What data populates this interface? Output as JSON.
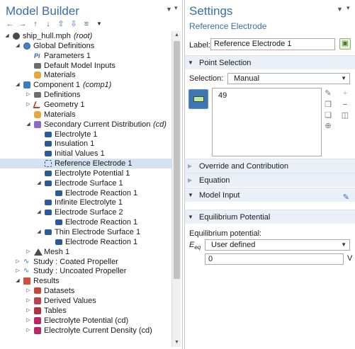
{
  "left": {
    "title": "Model Builder",
    "pin_icon": "pin-icon",
    "toolbar": [
      "back-icon",
      "forward-icon",
      "move-up-icon",
      "move-down-icon",
      "expand-all-icon",
      "sort-icon",
      "menu-icon"
    ],
    "tree": [
      {
        "label": "ship_hull.mph",
        "suffix": "(root)",
        "depth": 0,
        "expander": "expanded",
        "icon": "file"
      },
      {
        "label": "Global Definitions",
        "suffix": "",
        "depth": 1,
        "expander": "expanded",
        "icon": "globe"
      },
      {
        "label": "Parameters 1",
        "suffix": "",
        "depth": 2,
        "expander": "none",
        "icon": "param"
      },
      {
        "label": "Default Model Inputs",
        "suffix": "",
        "depth": 2,
        "expander": "none",
        "icon": "defs"
      },
      {
        "label": "Materials",
        "suffix": "",
        "depth": 2,
        "expander": "none",
        "icon": "mat"
      },
      {
        "label": "Component 1",
        "suffix": "(comp1)",
        "depth": 1,
        "expander": "expanded",
        "icon": "comp"
      },
      {
        "label": "Definitions",
        "suffix": "",
        "depth": 2,
        "expander": "collapsed",
        "icon": "defs"
      },
      {
        "label": "Geometry 1",
        "suffix": "",
        "depth": 2,
        "expander": "collapsed",
        "icon": "geo"
      },
      {
        "label": "Materials",
        "suffix": "",
        "depth": 2,
        "expander": "none",
        "icon": "mat"
      },
      {
        "label": "Secondary Current Distribution",
        "suffix": "(cd)",
        "depth": 2,
        "expander": "expanded",
        "icon": "physics"
      },
      {
        "label": "Electrolyte 1",
        "suffix": "",
        "depth": 3,
        "expander": "none",
        "icon": "node"
      },
      {
        "label": "Insulation 1",
        "suffix": "",
        "depth": 3,
        "expander": "none",
        "icon": "node"
      },
      {
        "label": "Initial Values 1",
        "suffix": "",
        "depth": 3,
        "expander": "none",
        "icon": "node"
      },
      {
        "label": "Reference Electrode 1",
        "suffix": "",
        "depth": 3,
        "expander": "none",
        "icon": "refel",
        "selected": true
      },
      {
        "label": "Electrolyte Potential 1",
        "suffix": "",
        "depth": 3,
        "expander": "none",
        "icon": "node"
      },
      {
        "label": "Electrode Surface 1",
        "suffix": "",
        "depth": 3,
        "expander": "expanded",
        "icon": "node"
      },
      {
        "label": "Electrode Reaction 1",
        "suffix": "",
        "depth": 4,
        "expander": "none",
        "icon": "node"
      },
      {
        "label": "Infinite Electrolyte 1",
        "suffix": "",
        "depth": 3,
        "expander": "none",
        "icon": "node"
      },
      {
        "label": "Electrode Surface 2",
        "suffix": "",
        "depth": 3,
        "expander": "expanded",
        "icon": "node"
      },
      {
        "label": "Electrode Reaction 1",
        "suffix": "",
        "depth": 4,
        "expander": "none",
        "icon": "node"
      },
      {
        "label": "Thin Electrode Surface 1",
        "suffix": "",
        "depth": 3,
        "expander": "expanded",
        "icon": "node"
      },
      {
        "label": "Electrode Reaction 1",
        "suffix": "",
        "depth": 4,
        "expander": "none",
        "icon": "node"
      },
      {
        "label": "Mesh 1",
        "suffix": "",
        "depth": 2,
        "expander": "collapsed",
        "icon": "mesh"
      },
      {
        "label": "Study : Coated Propeller",
        "suffix": "",
        "depth": 1,
        "expander": "collapsed",
        "icon": "study"
      },
      {
        "label": "Study : Uncoated Propeller",
        "suffix": "",
        "depth": 1,
        "expander": "collapsed",
        "icon": "study"
      },
      {
        "label": "Results",
        "suffix": "",
        "depth": 1,
        "expander": "expanded",
        "icon": "results"
      },
      {
        "label": "Datasets",
        "suffix": "",
        "depth": 2,
        "expander": "collapsed",
        "icon": "dataset"
      },
      {
        "label": "Derived Values",
        "suffix": "",
        "depth": 2,
        "expander": "collapsed",
        "icon": "derived"
      },
      {
        "label": "Tables",
        "suffix": "",
        "depth": 2,
        "expander": "collapsed",
        "icon": "table"
      },
      {
        "label": "Electrolyte Potential (cd)",
        "suffix": "",
        "depth": 2,
        "expander": "collapsed",
        "icon": "plot"
      },
      {
        "label": "Electrolyte Current Density (cd)",
        "suffix": "",
        "depth": 2,
        "expander": "collapsed",
        "icon": "plot"
      }
    ]
  },
  "right": {
    "title": "Settings",
    "subtitle": "Reference Electrode",
    "label_caption": "Label:",
    "label_value": "Reference Electrode 1",
    "sections": {
      "point_selection": "Point Selection",
      "override": "Override and Contribution",
      "equation": "Equation",
      "model_input": "Model Input",
      "equilibrium": "Equilibrium Potential"
    },
    "selection_caption": "Selection:",
    "selection_value": "Manual",
    "selected_entity": "49",
    "eq_caption": "Equilibrium potential:",
    "eq_symbol": "E",
    "eq_subscript": "eq",
    "eq_source": "User defined",
    "eq_value": "0",
    "eq_unit": "V"
  }
}
